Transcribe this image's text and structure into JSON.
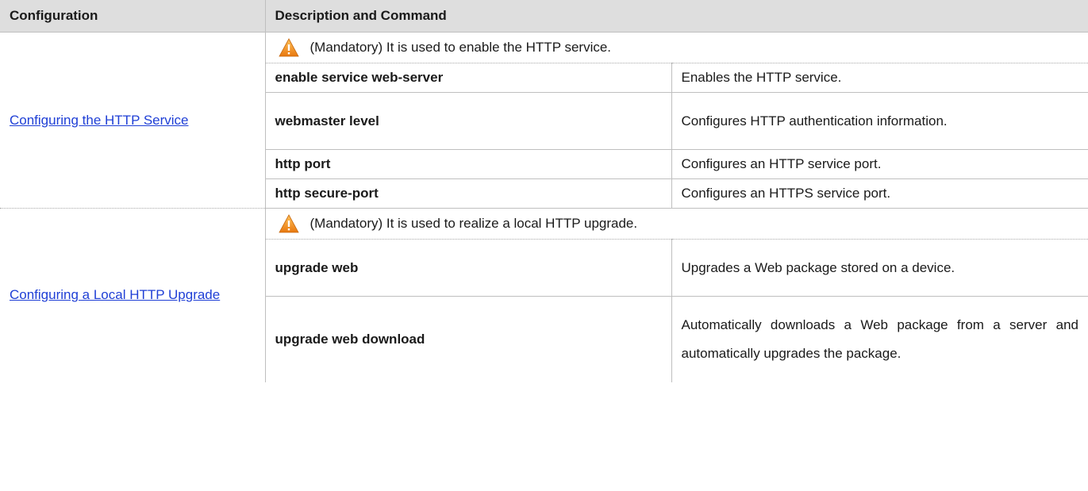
{
  "header": {
    "col1": "Configuration",
    "col2": "Description and Command"
  },
  "sections": [
    {
      "config_link": "Configuring the HTTP Service",
      "note": "(Mandatory) It is used to enable the HTTP service.",
      "commands": [
        {
          "name": "enable service web-server",
          "desc": "Enables the HTTP service."
        },
        {
          "name": "webmaster level",
          "desc": "Configures HTTP authentication information."
        },
        {
          "name": "http port",
          "desc": "Configures an HTTP service port."
        },
        {
          "name": "http secure-port",
          "desc": "Configures an HTTPS service port."
        }
      ]
    },
    {
      "config_link": "Configuring a Local HTTP Upgrade",
      "note": "(Mandatory) It is used to realize a local HTTP upgrade.",
      "commands": [
        {
          "name": "upgrade web",
          "desc": "Upgrades a Web package stored on a device."
        },
        {
          "name": "upgrade web download",
          "desc": "Automatically downloads a Web package from a server and automatically upgrades the package."
        }
      ]
    }
  ],
  "icons": {
    "note_icon": "warning-triangle-icon",
    "warning_color": "#f39a1e"
  }
}
